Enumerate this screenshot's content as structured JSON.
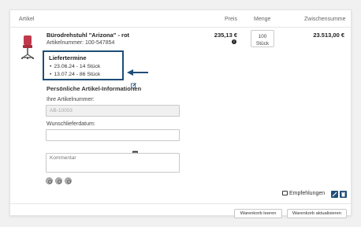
{
  "table": {
    "headers": {
      "article": "Artikel",
      "price": "Preis",
      "quantity": "Menge",
      "subtotal": "Zwischensumme"
    }
  },
  "item": {
    "name": "Bürodrehstuhl \"Arizona\" - rot",
    "article_number": "Artikelnummer: 100-547854",
    "price": "235,13 €",
    "quantity_value": "100",
    "quantity_unit": "Stück",
    "subtotal": "23.513,00 €",
    "info_icon": "i"
  },
  "delivery": {
    "title": "Liefertermine",
    "dates": [
      {
        "text": "23.06.24  -  14 Stück"
      },
      {
        "text": "13.07.24  -  86 Stück"
      }
    ]
  },
  "personal": {
    "title": "Persönliche Artikel-Informationen",
    "article_number_label": "Ihre Artikelnummer:",
    "article_number_value": "AB-10003",
    "delivery_date_label": "Wunschlieferdatum:",
    "delivery_date_value": "",
    "comment_placeholder": "Kommentar"
  },
  "actions": {
    "recommendations": "Empfehlungen",
    "clear_cart": "Warenkorb leeren",
    "update_cart": "Warenkorb aktualisieren"
  },
  "colors": {
    "accent": "#1f4e79",
    "highlight_border": "#1f4e79"
  },
  "icons": {
    "edit": "pencil-icon",
    "delete": "trash-icon",
    "calendar": "calendar-icon",
    "info": "info-icon",
    "arrow": "arrow-left-icon"
  }
}
